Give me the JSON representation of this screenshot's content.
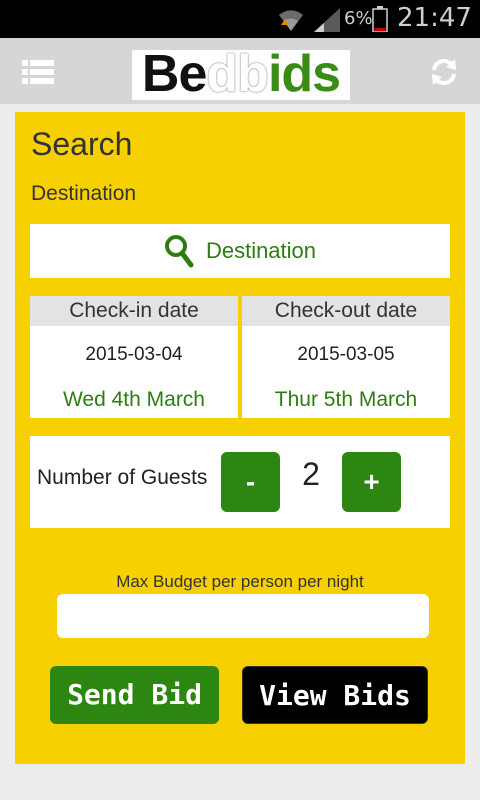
{
  "status_bar": {
    "battery_percent": "6%",
    "time": "21:47",
    "icons": [
      "wifi-icon",
      "signal-icon",
      "battery-icon"
    ]
  },
  "app_bar": {
    "logo": {
      "text": "Bedbids",
      "parts": [
        "Be",
        "db",
        "ids"
      ],
      "colors": [
        "#111111",
        "#ffffff",
        "#3a8c14"
      ]
    },
    "icons": [
      "menu-icon",
      "refresh-icon"
    ]
  },
  "search": {
    "title": "Search",
    "destination_label": "Destination",
    "destination_placeholder": "Destination",
    "checkin": {
      "header": "Check-in date",
      "date": "2015-03-04",
      "human": "Wed 4th March"
    },
    "checkout": {
      "header": "Check-out date",
      "date": "2015-03-05",
      "human": "Thur 5th March"
    },
    "guests": {
      "label": "Number of Guests",
      "count": "2",
      "minus": "-",
      "plus": "+"
    },
    "budget": {
      "label": "Max Budget per person per night",
      "value": ""
    },
    "buttons": {
      "send_bid": "Send Bid",
      "view_bids": "View Bids"
    }
  },
  "colors": {
    "panel": "#f6d000",
    "accent_green": "#2e8612",
    "app_bar": "#d6d6d6"
  }
}
